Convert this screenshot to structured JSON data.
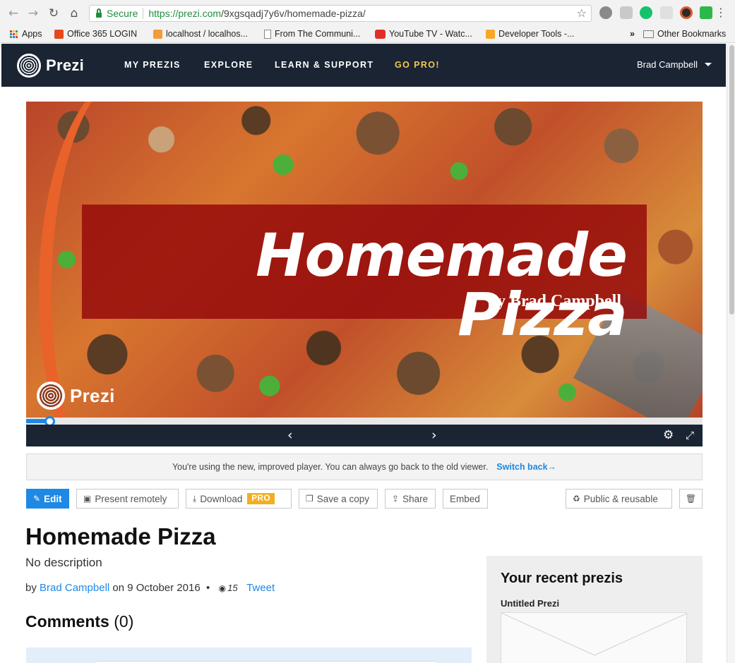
{
  "browser": {
    "secure_label": "Secure",
    "url_host": "https://prezi.com",
    "url_path": "/9xgsqadj7y6v/homemade-pizza/",
    "bookmarks": [
      {
        "label": "Apps",
        "icon": "apps-grid-icon"
      },
      {
        "label": "Office 365 LOGIN",
        "icon": "office-icon"
      },
      {
        "label": "localhost / localhos...",
        "icon": "localhost-icon"
      },
      {
        "label": "From The Communi...",
        "icon": "page-icon"
      },
      {
        "label": "YouTube TV - Watc...",
        "icon": "youtube-icon"
      },
      {
        "label": "Developer Tools -...",
        "icon": "w3-icon"
      }
    ],
    "other_bookmarks": "Other Bookmarks",
    "overflow": "»"
  },
  "header": {
    "logo": "Prezi",
    "nav": [
      "MY PREZIS",
      "EXPLORE",
      "LEARN & SUPPORT",
      "GO PRO!"
    ],
    "user": "Brad Campbell"
  },
  "player": {
    "slide_title": "Homemade Pizza",
    "slide_subtitle": "by Brad Campbell",
    "slide_logo": "Prezi",
    "progress_fraction": 0.035,
    "prev": "‹",
    "next": "›",
    "settings_icon": "gear-icon",
    "fullscreen_icon": "fullscreen-icon"
  },
  "notice": {
    "text": "You're using the new, improved player. You can always go back to the old viewer.",
    "link": "Switch back→"
  },
  "actions": {
    "edit": "Edit",
    "present": "Present remotely",
    "download": "Download",
    "pro": "PRO",
    "save_copy": "Save a copy",
    "share": "Share",
    "embed": "Embed",
    "visibility": "Public & reusable"
  },
  "details": {
    "title": "Homemade Pizza",
    "description": "No description",
    "by": "by",
    "author": "Brad Campbell",
    "date": "on 9 October 2016",
    "bullet": "•",
    "views": "15",
    "tweet": "Tweet",
    "comments_label": "Comments",
    "comments_count": "(0)"
  },
  "sidebar": {
    "title": "Your recent prezis",
    "recent": [
      "Untitled Prezi"
    ]
  },
  "colors": {
    "accent": "#1e88e5",
    "header_bg": "#1a2433",
    "go_pro": "#f2c94c",
    "pro_badge": "#f2b01e",
    "banner": "#960c0c"
  }
}
